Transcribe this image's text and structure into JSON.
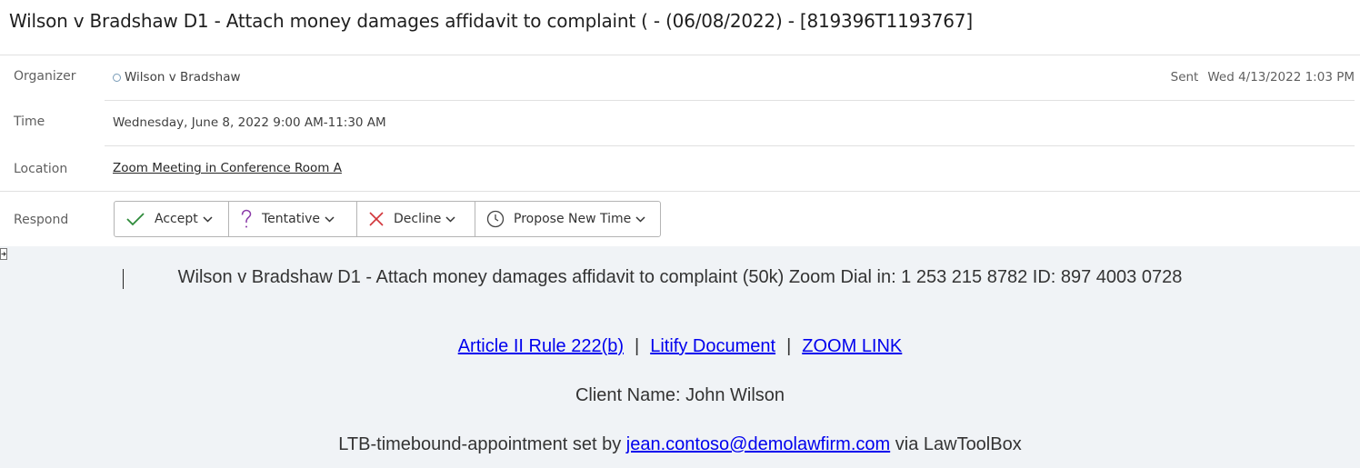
{
  "subject": "Wilson v Bradshaw D1 - Attach money damages affidavit to complaint ( - (06/08/2022) - [819396T1193767]",
  "meta": {
    "organizer_label": "Organizer",
    "organizer_value": "Wilson v Bradshaw",
    "sent_label": "Sent",
    "sent_value": "Wed 4/13/2022 1:03 PM",
    "time_label": "Time",
    "time_value": "Wednesday, June 8, 2022 9:00 AM-11:30 AM",
    "location_label": "Location",
    "location_value": "Zoom Meeting in Conference Room A",
    "respond_label": "Respond"
  },
  "respond": {
    "accept": "Accept",
    "tentative": "Tentative",
    "decline": "Decline",
    "propose": "Propose New Time"
  },
  "body": {
    "line1": "Wilson v Bradshaw D1 - Attach money damages affidavit to complaint (50k) Zoom Dial in: 1 253 215 8782 ID: 897 4003 0728",
    "link1": "Article II Rule 222(b)",
    "link2": "Litify Document",
    "link3": "ZOOM LINK",
    "separator": "|",
    "client": "Client Name: John Wilson",
    "ltb_prefix": "LTB-timebound-appointment set by",
    "ltb_email": "jean.contoso@demolawfirm.com",
    "ltb_suffix": "via LawToolBox"
  },
  "colors": {
    "accept": "#2e8b3a",
    "tentative": "#8a3aa8",
    "decline": "#d13438",
    "link": "#0000ee",
    "body_bg": "#f0f3f6"
  },
  "icons": {
    "accept": "check-icon",
    "tentative": "question-icon",
    "decline": "x-icon",
    "propose": "clock-icon"
  }
}
